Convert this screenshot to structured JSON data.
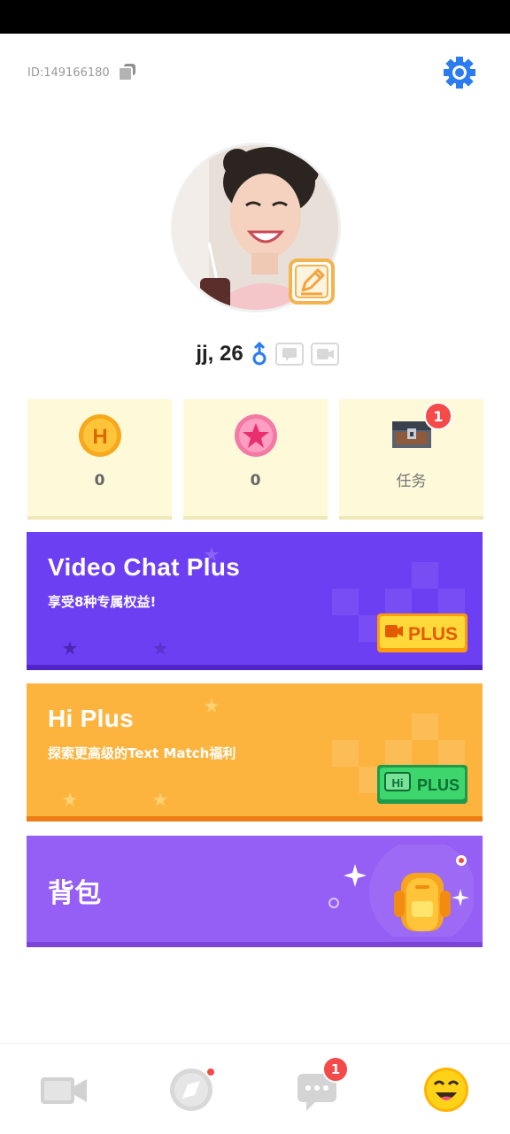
{
  "header": {
    "user_id_text": "ID:149166180",
    "copy_icon": "copy-icon",
    "settings_icon": "gear-icon"
  },
  "profile": {
    "name_age": "jj, 26",
    "gender_icon": "male-icon",
    "edit_icon": "pencil-icon",
    "chip_icons": [
      "chat-hi-icon",
      "video-card-icon"
    ]
  },
  "stats": [
    {
      "icon": "h-coin-icon",
      "value": "0"
    },
    {
      "icon": "star-coin-icon",
      "value": "0"
    },
    {
      "icon": "treasure-chest-icon",
      "label": "任务",
      "badge": "1"
    }
  ],
  "banners": {
    "video_chat_plus": {
      "title": "Video Chat Plus",
      "subtitle": "享受8种专属权益!",
      "button_text": "PLUS"
    },
    "hi_plus": {
      "title": "Hi Plus",
      "subtitle": "探索更高级的Text Match福利",
      "button_text": "PLUS",
      "button_prefix": "Hi"
    },
    "backpack": {
      "title": "背包"
    }
  },
  "tabbar": {
    "items": [
      {
        "name": "video",
        "icon": "video-camera-icon"
      },
      {
        "name": "discover",
        "icon": "compass-icon"
      },
      {
        "name": "messages",
        "icon": "chat-bubble-icon",
        "badge": "1"
      },
      {
        "name": "me",
        "icon": "smiley-face-icon"
      }
    ]
  },
  "colors": {
    "accent_blue": "#2b7cf0",
    "card_bg": "#fdf9d9",
    "vcp_purple": "#6d3ff3",
    "hip_orange": "#fdb43f",
    "bag_purple": "#955ef5",
    "badge_red": "#f44a4a"
  }
}
